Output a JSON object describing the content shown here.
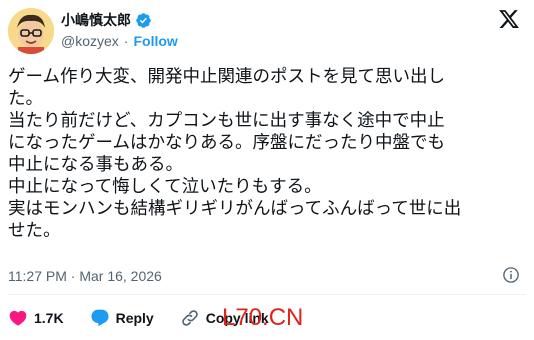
{
  "author": {
    "display_name": "小嶋慎太郎",
    "handle": "@kozyex",
    "separator": "·",
    "follow_label": "Follow",
    "verified_color": "#1d9bf0"
  },
  "post": {
    "lines": [
      "ゲーム作り大変、開発中止関連のポストを見て思い出し",
      "た。",
      "当たり前だけど、カプコンも世に出す事なく途中で中止",
      "になったゲームはかなりある。序盤にだったり中盤でも",
      "中止になる事もある。",
      "中止になって悔しくて泣いたりもする。",
      "実はモンハンも結構ギリギリがんばってふんばって世に出",
      "せた。"
    ],
    "timestamp": "11:27 PM · Mar 16, 2026"
  },
  "actions": {
    "like_count": "1.7K",
    "reply_label": "Reply",
    "copy_link_label": "Copy link"
  },
  "watermark": "L70.CN",
  "icons": [
    "x-logo-icon",
    "verified-badge-icon",
    "info-icon",
    "heart-icon",
    "reply-icon",
    "link-icon"
  ]
}
